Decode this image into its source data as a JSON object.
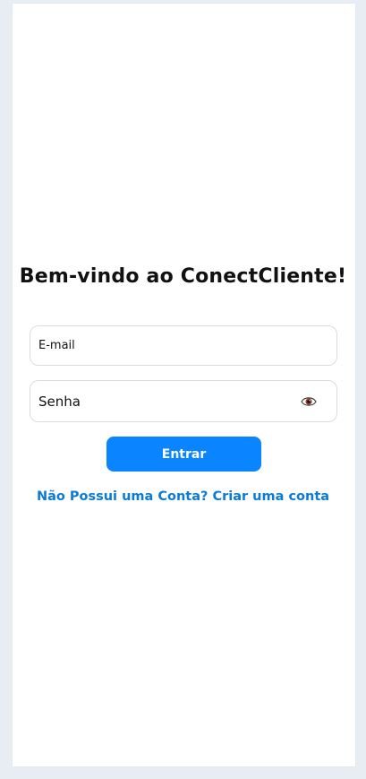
{
  "login": {
    "title": "Bem-vindo ao ConectCliente!",
    "email_placeholder": "E-mail",
    "email_value": "",
    "password_placeholder": "Senha",
    "password_value": "",
    "submit_label": "Entrar",
    "signup_link": "Não Possui uma Conta? Criar uma conta"
  },
  "icons": {
    "toggle_password": "eye-icon"
  },
  "colors": {
    "background": "#e8edf4",
    "card": "#ffffff",
    "primary_button": "#0a84ff",
    "link": "#0a7bd6",
    "input_border": "#d9dde3"
  }
}
